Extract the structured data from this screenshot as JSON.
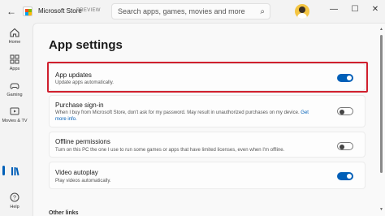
{
  "titlebar": {
    "app_title": "Microsoft Store",
    "badge": "PREVIEW",
    "search_placeholder": "Search apps, games, movies and more",
    "back_glyph": "←",
    "min_glyph": "—",
    "max_glyph": "☐",
    "close_glyph": "✕",
    "search_glyph": "⌕"
  },
  "sidebar": {
    "items": [
      {
        "label": "Home",
        "icon": "home-icon"
      },
      {
        "label": "Apps",
        "icon": "apps-icon"
      },
      {
        "label": "Gaming",
        "icon": "gaming-icon"
      },
      {
        "label": "Movies & TV",
        "icon": "movies-icon"
      },
      {
        "label": "",
        "icon": "library-icon"
      },
      {
        "label": "Help",
        "icon": "help-icon"
      }
    ]
  },
  "main": {
    "title": "App settings",
    "settings": [
      {
        "title": "App updates",
        "desc": "Update apps automatically.",
        "enabled": true
      },
      {
        "title": "Purchase sign-in",
        "desc": "When I buy from Microsoft Store, don't ask for my password. May result in unauthorized purchases on my device.",
        "link": "Get more info.",
        "enabled": false
      },
      {
        "title": "Offline permissions",
        "desc": "Turn on this PC the one I use to run some games or apps that have limited licenses, even when I'm offline.",
        "enabled": false
      },
      {
        "title": "Video autoplay",
        "desc": "Play videos automatically.",
        "enabled": true
      }
    ],
    "other_links": "Other links"
  },
  "colors": {
    "accent": "#005fb8",
    "highlight": "#d0202e"
  }
}
